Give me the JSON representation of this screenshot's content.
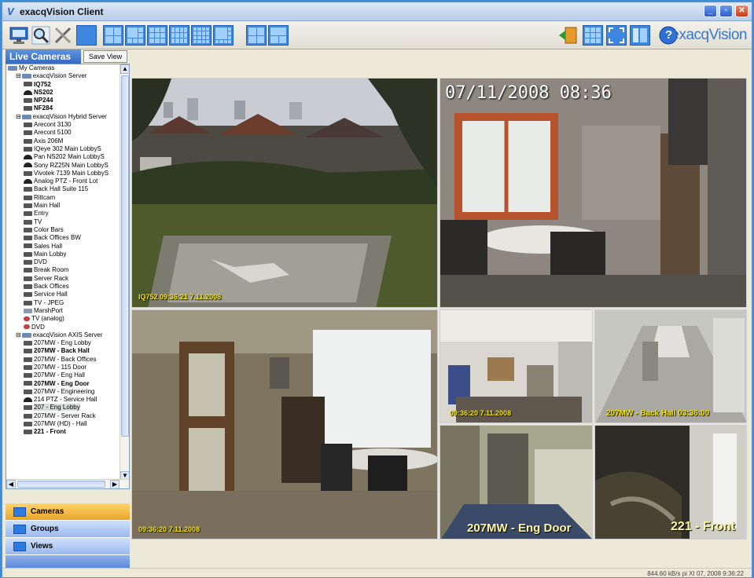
{
  "window": {
    "title": "exacqVision Client",
    "logo": "V"
  },
  "toolbar": {
    "brand_prefix": "exacq",
    "brand_suffix": "Vision",
    "help_label": "?"
  },
  "left_panel": {
    "live_tab": "Live Cameras",
    "save_view": "Save View",
    "tree": [
      {
        "label": "My Cameras",
        "indent": 0,
        "icon": "mycams",
        "bold": false
      },
      {
        "label": "exacqVision Server",
        "indent": 1,
        "icon": "srv",
        "bold": false
      },
      {
        "label": "IQ752",
        "indent": 2,
        "icon": "cam",
        "bold": true
      },
      {
        "label": "NS202",
        "indent": 2,
        "icon": "ptz",
        "bold": true
      },
      {
        "label": "NP244",
        "indent": 2,
        "icon": "cam",
        "bold": true
      },
      {
        "label": "NF284",
        "indent": 2,
        "icon": "cam",
        "bold": true
      },
      {
        "label": "exacqVision Hybrid Server",
        "indent": 1,
        "icon": "srv",
        "bold": false
      },
      {
        "label": "Arecont 3130",
        "indent": 2,
        "icon": "cam",
        "bold": false
      },
      {
        "label": "Arecont 5100",
        "indent": 2,
        "icon": "cam",
        "bold": false
      },
      {
        "label": "Axis 206M",
        "indent": 2,
        "icon": "cam",
        "bold": false
      },
      {
        "label": "IQeye 302 Main LobbyS",
        "indent": 2,
        "icon": "cam",
        "bold": false
      },
      {
        "label": "Pan NS202 Main LobbyS",
        "indent": 2,
        "icon": "ptz",
        "bold": false
      },
      {
        "label": "Sony RZ25N Main LobbyS",
        "indent": 2,
        "icon": "ptz",
        "bold": false
      },
      {
        "label": "Vivotek 7139 Main LobbyS",
        "indent": 2,
        "icon": "cam",
        "bold": false
      },
      {
        "label": "Analog PTZ - Front Lot",
        "indent": 2,
        "icon": "ptz",
        "bold": false
      },
      {
        "label": "Back Hall Suite 115",
        "indent": 2,
        "icon": "cam",
        "bold": false
      },
      {
        "label": "Rittcam",
        "indent": 2,
        "icon": "cam",
        "bold": false
      },
      {
        "label": "Main Hall",
        "indent": 2,
        "icon": "cam",
        "bold": false
      },
      {
        "label": "Entry",
        "indent": 2,
        "icon": "cam",
        "bold": false
      },
      {
        "label": "TV",
        "indent": 2,
        "icon": "cam",
        "bold": false
      },
      {
        "label": "Color Bars",
        "indent": 2,
        "icon": "cam",
        "bold": false
      },
      {
        "label": "Back Offices BW",
        "indent": 2,
        "icon": "cam",
        "bold": false
      },
      {
        "label": "Sales Hall",
        "indent": 2,
        "icon": "cam",
        "bold": false
      },
      {
        "label": "Main Lobby",
        "indent": 2,
        "icon": "cam",
        "bold": false
      },
      {
        "label": "DVD",
        "indent": 2,
        "icon": "cam",
        "bold": false
      },
      {
        "label": "Break Room",
        "indent": 2,
        "icon": "cam",
        "bold": false
      },
      {
        "label": "Server Rack",
        "indent": 2,
        "icon": "cam",
        "bold": false
      },
      {
        "label": "Back Offices",
        "indent": 2,
        "icon": "cam",
        "bold": false
      },
      {
        "label": "Service Hall",
        "indent": 2,
        "icon": "cam",
        "bold": false
      },
      {
        "label": "TV - JPEG",
        "indent": 2,
        "icon": "cam",
        "bold": false
      },
      {
        "label": "MarshPort",
        "indent": 2,
        "icon": "mp",
        "bold": false
      },
      {
        "label": "TV (analog)",
        "indent": 2,
        "icon": "rad",
        "bold": false
      },
      {
        "label": "DVD",
        "indent": 2,
        "icon": "rad",
        "bold": false
      },
      {
        "label": "exacqVision AXIS Server",
        "indent": 1,
        "icon": "srv",
        "bold": false
      },
      {
        "label": "207MW - Eng Lobby",
        "indent": 2,
        "icon": "cam",
        "bold": false
      },
      {
        "label": "207MW - Back Hall",
        "indent": 2,
        "icon": "cam",
        "bold": true
      },
      {
        "label": "207MW - Back Offices",
        "indent": 2,
        "icon": "cam",
        "bold": false
      },
      {
        "label": "207MW - 115 Door",
        "indent": 2,
        "icon": "cam",
        "bold": false
      },
      {
        "label": "207MW - Eng Hall",
        "indent": 2,
        "icon": "cam",
        "bold": false
      },
      {
        "label": "207MW - Eng Door",
        "indent": 2,
        "icon": "cam",
        "bold": true
      },
      {
        "label": "207MW - Engineering",
        "indent": 2,
        "icon": "cam",
        "bold": false
      },
      {
        "label": "214 PTZ - Service Hall",
        "indent": 2,
        "icon": "ptz",
        "bold": false
      },
      {
        "label": "207 - Eng Lobby",
        "indent": 2,
        "icon": "cam",
        "bold": false,
        "selected": true
      },
      {
        "label": "207MW - Server Rack",
        "indent": 2,
        "icon": "cam",
        "bold": false
      },
      {
        "label": "207MW (HD) - Hall",
        "indent": 2,
        "icon": "cam",
        "bold": false
      },
      {
        "label": "221 - Front",
        "indent": 2,
        "icon": "cam",
        "bold": true
      }
    ],
    "nav": {
      "cameras": "Cameras",
      "groups": "Groups",
      "views": "Views"
    }
  },
  "cameras": {
    "cam1": {
      "osd": "IQ752 09:36:21 7.11.2008"
    },
    "cam2": {
      "osd": "07/11/2008 08:36"
    },
    "cam3": {
      "osd": "09:36:20 7.11.2008"
    },
    "cam4": {
      "osd": "09:36:20 7.11.2008"
    },
    "cam5": {
      "osd": "207MW - Back Hall 03:36:00"
    },
    "cam6": {
      "osd": "207MW - Eng Door"
    },
    "cam7": {
      "osd": "221 - Front"
    }
  },
  "status": {
    "text": "844.60 kB/s   pi XI 07, 2008   9:36:22"
  }
}
